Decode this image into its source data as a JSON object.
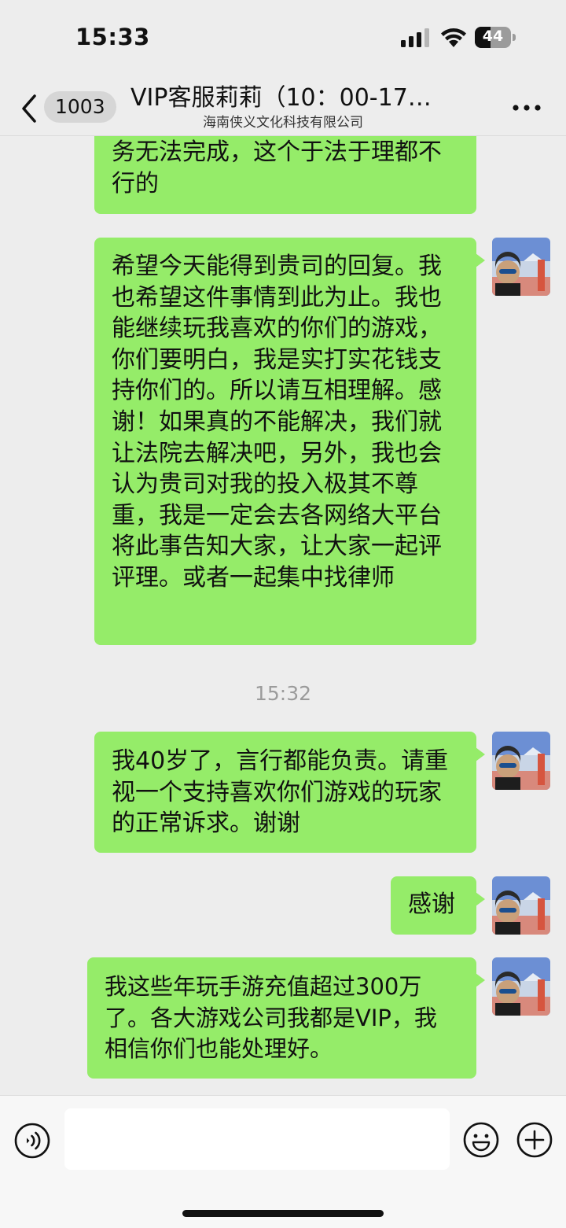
{
  "status_bar": {
    "time": "15:33",
    "battery": "44"
  },
  "nav": {
    "back_count": "1003",
    "title": "VIP客服莉莉（10：00-17…",
    "subtitle": "海南侠义文化科技有限公司",
    "icons": {
      "back": "chevron-left-icon",
      "more": "more-dots-icon"
    }
  },
  "messages": {
    "m1": {
      "text": "务无法完成，这个于法于理都不行的"
    },
    "m2": {
      "text": "希望今天能得到贵司的回复。我也希望这件事情到此为止。我也能继续玩我喜欢的你们的游戏，你们要明白，我是实打实花钱支持你们的。所以请互相理解。感谢！如果真的不能解决，我们就让法院去解决吧，另外，我也会认为贵司对我的投入极其不尊重，我是一定会去各网络大平台将此事告知大家，让大家一起评评理。或者一起集中找律师"
    },
    "ts": "15:32",
    "m3": {
      "text": "我40岁了，言行都能负责。请重视一个支持喜欢你们游戏的玩家的正常诉求。谢谢"
    },
    "m4": {
      "text": "感谢"
    },
    "m5": {
      "text": "我这些年玩手游充值超过300万了。各大游戏公司我都是VIP，我相信你们也能处理好。"
    }
  },
  "input": {
    "value": "",
    "icons": {
      "voice": "voice-icon",
      "emoji": "emoji-icon",
      "plus": "plus-icon"
    }
  },
  "colors": {
    "bubble": "#95ec69",
    "background": "#ededed",
    "timestamp": "#9b9b9b"
  }
}
